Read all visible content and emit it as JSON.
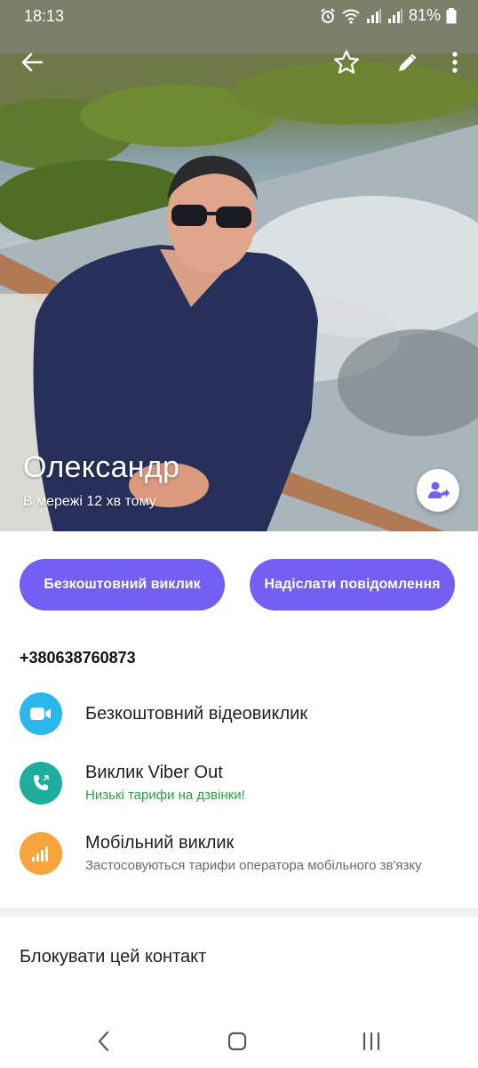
{
  "status_bar": {
    "time": "18:13",
    "battery": "81%"
  },
  "header": {
    "icons": [
      "back-arrow-icon",
      "star-icon",
      "pencil-icon",
      "more-vertical-icon"
    ]
  },
  "contact": {
    "name": "Олександр",
    "status": "В мережі 12 хв тому"
  },
  "actions": {
    "free_call": "Безкоштовний виклик",
    "send_message": "Надіслати повідомлення"
  },
  "phone": "+380638760873",
  "options": [
    {
      "title": "Безкоштовний відеовиклик",
      "subtitle": "",
      "icon": "video-camera-icon",
      "color": "#2bb7ea"
    },
    {
      "title": "Виклик Viber Out",
      "subtitle": "Низькі тарифи на дзвінки!",
      "icon": "phone-out-icon",
      "color": "#1fae9d",
      "subtitle_color": "#2e9e3d"
    },
    {
      "title": "Мобільний виклик",
      "subtitle": "Застосовуються тарифи оператора мобільного зв'язку",
      "icon": "signal-bars-icon",
      "color": "#f7a43c",
      "subtitle_color": "#6b6b6b"
    }
  ],
  "block_contact": "Блокувати цей контакт",
  "colors": {
    "accent": "#7360f2"
  }
}
